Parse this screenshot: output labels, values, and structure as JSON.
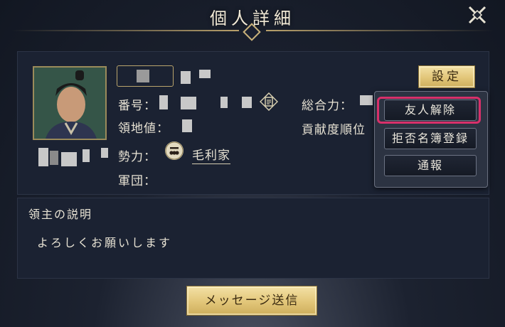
{
  "header": {
    "title": "個人詳細",
    "close_icon": "close-icon"
  },
  "profile": {
    "number_label": "番号：",
    "territory_label": "領地値：",
    "force_label": "勢力：",
    "force_name": "毛利家",
    "corps_label": "軍団：",
    "total_power_label": "総合力：",
    "contribution_rank_label": "貢献度順位"
  },
  "actions": {
    "settings_label": "設定",
    "menu": [
      {
        "label": "友人解除"
      },
      {
        "label": "拒否名簿登録"
      },
      {
        "label": "通報"
      }
    ],
    "message_label": "メッセージ送信"
  },
  "description": {
    "title": "領主の説明",
    "text": "よろしくお願いします"
  },
  "colors": {
    "accent_gold": "#e2c679",
    "highlight": "#d8306a",
    "panel": "#1b2232"
  }
}
